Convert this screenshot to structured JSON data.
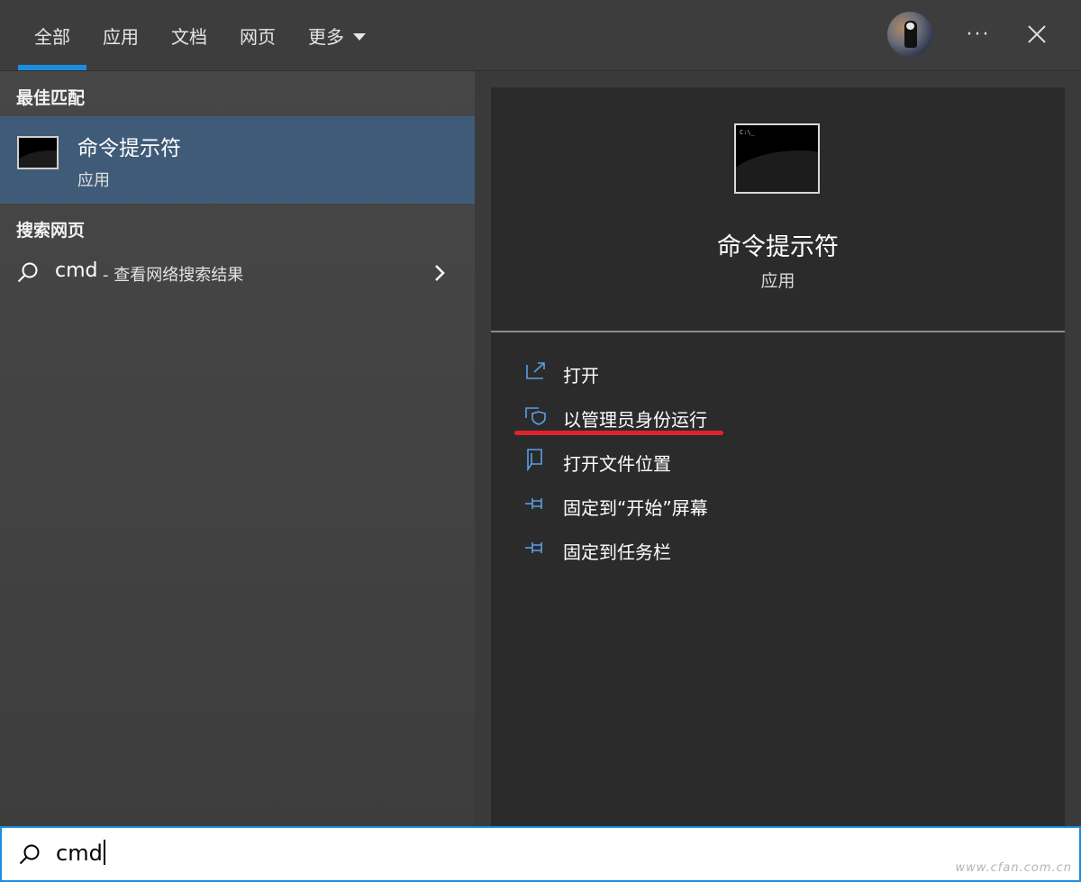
{
  "tabs": [
    {
      "label": "全部",
      "active": true
    },
    {
      "label": "应用"
    },
    {
      "label": "文档"
    },
    {
      "label": "网页"
    },
    {
      "label": "更多"
    }
  ],
  "header": {
    "more_label": "···",
    "accent": "#1a8fe0"
  },
  "best_match": {
    "section_title": "最佳匹配",
    "name": "命令提示符",
    "type": "应用",
    "highlight_color": "#3f5b78"
  },
  "web_search": {
    "section_title": "搜索网页",
    "query": "cmd",
    "suffix": "- 查看网络搜索结果"
  },
  "detail": {
    "icon_text": "C:\\_",
    "name": "命令提示符",
    "type": "应用",
    "actions": [
      {
        "label": "打开",
        "icon": "open-icon"
      },
      {
        "label": "以管理员身份运行",
        "icon": "run-as-admin-icon",
        "underlined": true
      },
      {
        "label": "打开文件位置",
        "icon": "file-location-icon"
      },
      {
        "label": "固定到“开始”屏幕",
        "icon": "pin-icon"
      },
      {
        "label": "固定到任务栏",
        "icon": "pin-icon"
      }
    ],
    "underline_color": "#e0232f"
  },
  "search_box": {
    "value": "cmd"
  },
  "watermark": "www.cfan.com.cn"
}
